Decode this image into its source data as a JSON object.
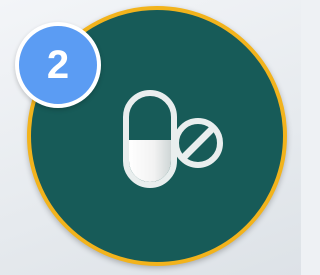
{
  "step": {
    "number": "2",
    "badge_color": "#5b9cf3"
  },
  "card": {
    "circle_color": "#175b58",
    "ring_color": "#f2b31c",
    "icon": "pills-icon"
  }
}
